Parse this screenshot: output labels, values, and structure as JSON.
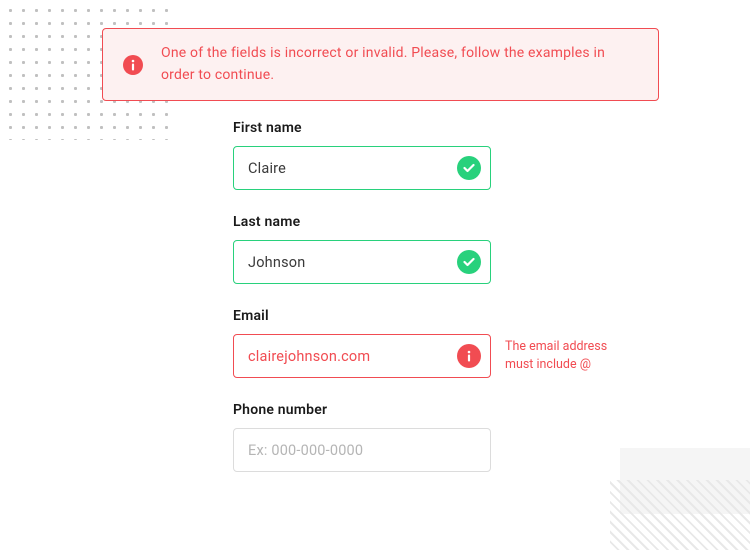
{
  "alert": {
    "message": "One of the fields is incorrect or invalid. Please, follow the examples in order to continue."
  },
  "fields": {
    "first_name": {
      "label": "First name",
      "value": "Claire"
    },
    "last_name": {
      "label": "Last name",
      "value": "Johnson"
    },
    "email": {
      "label": "Email",
      "value": "clairejohnson.com",
      "error": "The email address must include @"
    },
    "phone": {
      "label": "Phone number",
      "placeholder": "Ex: 000-000-0000"
    }
  },
  "colors": {
    "error": "#f14c52",
    "success": "#28d17c"
  }
}
